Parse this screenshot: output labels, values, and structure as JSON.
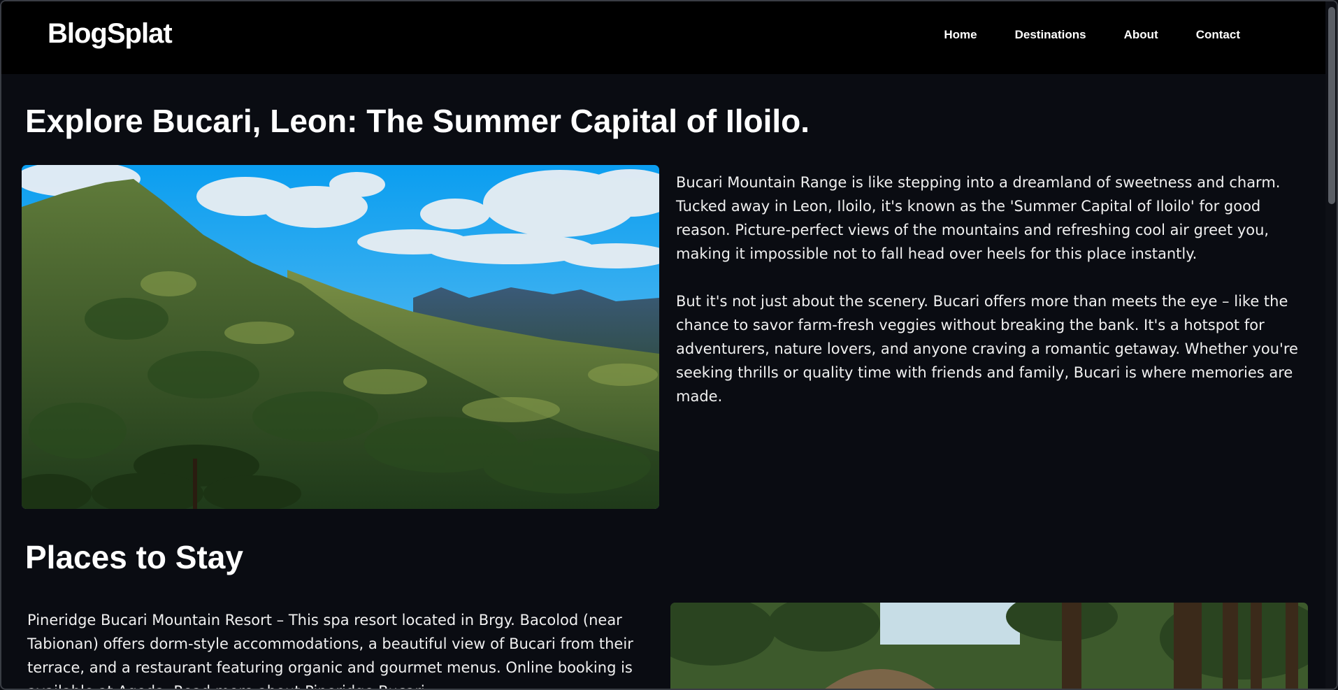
{
  "navbar": {
    "logo": "BlogSplat",
    "links": [
      "Home",
      "Destinations",
      "About",
      "Contact"
    ]
  },
  "article": {
    "title": "Explore Bucari, Leon: The Summer Capital of Iloilo.",
    "hero_image_alt": "mountain-range-landscape",
    "paragraphs": [
      "Bucari Mountain Range is like stepping into a dreamland of sweetness and charm. Tucked away in Leon, Iloilo, it's known as the 'Summer Capital of Iloilo' for good reason. Picture-perfect views of the mountains and refreshing cool air greet you, making it impossible not to fall head over heels for this place instantly.",
      "But it's not just about the scenery. Bucari offers more than meets the eye – like the chance to savor farm-fresh veggies without breaking the bank. It's a hotspot for adventurers, nature lovers, and anyone craving a romantic getaway. Whether you're seeking thrills or quality time with friends and family, Bucari is where memories are made."
    ]
  },
  "stay": {
    "heading": "Places to Stay",
    "paragraph": "Pineridge Bucari Mountain Resort – This spa resort located in Brgy. Bacolod (near Tabionan) offers dorm-style accommodations, a beautiful view of Bucari from their terrace, and a restaurant featuring organic and gourmet menus. Online booking is available at Agoda. Read more about Pineridge Bucari",
    "image_alt": "pine-forest-huts"
  },
  "colors": {
    "background": "#0a0c12",
    "navbar": "#000000",
    "text": "#f0f0f0"
  }
}
